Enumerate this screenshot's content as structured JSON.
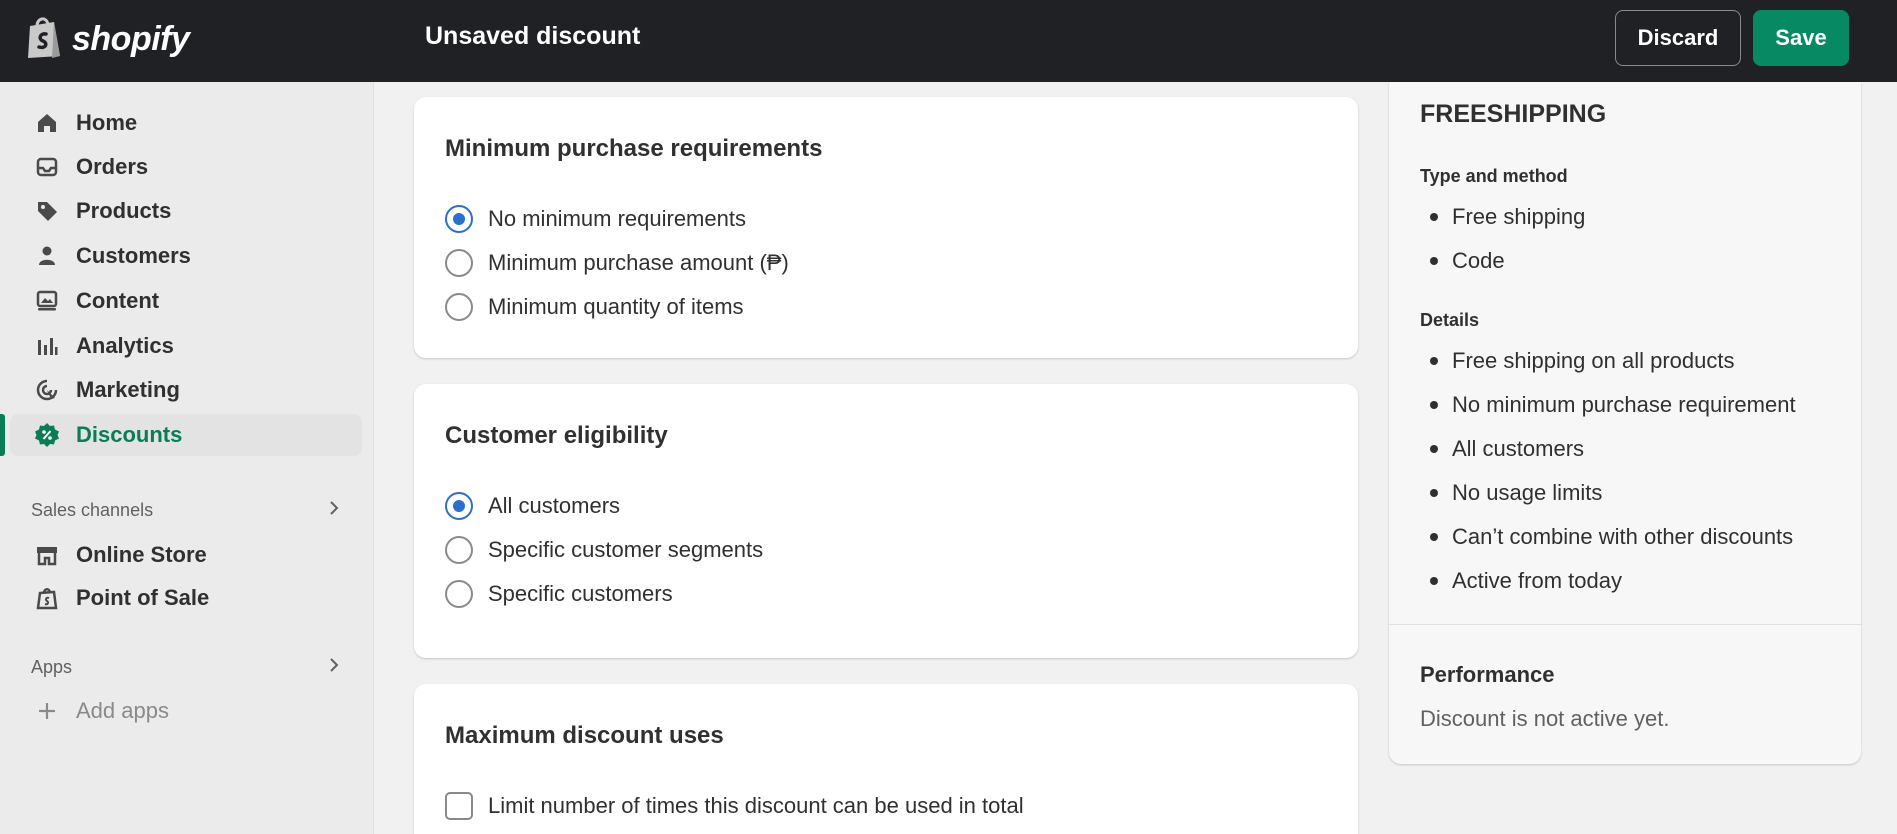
{
  "app": {
    "brand": "shopify",
    "page_title": "Unsaved discount",
    "discard_label": "Discard",
    "save_label": "Save"
  },
  "sidebar": {
    "items": [
      {
        "label": "Home",
        "icon": "home-icon"
      },
      {
        "label": "Orders",
        "icon": "inbox-icon"
      },
      {
        "label": "Products",
        "icon": "tag-icon"
      },
      {
        "label": "Customers",
        "icon": "person-icon"
      },
      {
        "label": "Content",
        "icon": "image-icon"
      },
      {
        "label": "Analytics",
        "icon": "bar-chart-icon"
      },
      {
        "label": "Marketing",
        "icon": "target-icon"
      },
      {
        "label": "Discounts",
        "icon": "discount-icon",
        "active": true
      }
    ],
    "sales_channels_label": "Sales channels",
    "channels": [
      {
        "label": "Online Store",
        "icon": "store-icon"
      },
      {
        "label": "Point of Sale",
        "icon": "pos-bag-icon"
      }
    ],
    "apps_label": "Apps",
    "add_apps_label": "Add apps"
  },
  "main": {
    "min_purchase": {
      "title": "Minimum purchase requirements",
      "options": [
        {
          "label": "No minimum requirements",
          "checked": true
        },
        {
          "label": "Minimum purchase amount (₱)",
          "checked": false
        },
        {
          "label": "Minimum quantity of items",
          "checked": false
        }
      ]
    },
    "eligibility": {
      "title": "Customer eligibility",
      "options": [
        {
          "label": "All customers",
          "checked": true
        },
        {
          "label": "Specific customer segments",
          "checked": false
        },
        {
          "label": "Specific customers",
          "checked": false
        }
      ]
    },
    "max_uses": {
      "title": "Maximum discount uses",
      "options": [
        {
          "label": "Limit number of times this discount can be used in total",
          "checked": false
        }
      ]
    }
  },
  "summary": {
    "code": "FREESHIPPING",
    "type_heading": "Type and method",
    "type_items": [
      "Free shipping",
      "Code"
    ],
    "details_heading": "Details",
    "details_items": [
      "Free shipping on all products",
      "No minimum purchase requirement",
      "All customers",
      "No usage limits",
      "Can’t combine with other discounts",
      "Active from today"
    ],
    "performance_heading": "Performance",
    "performance_text": "Discount is not active yet."
  },
  "colors": {
    "topbar": "#1f2124",
    "accent_green": "#078a64",
    "active_nav": "#0a7d57",
    "radio_blue": "#2c6ecb"
  }
}
